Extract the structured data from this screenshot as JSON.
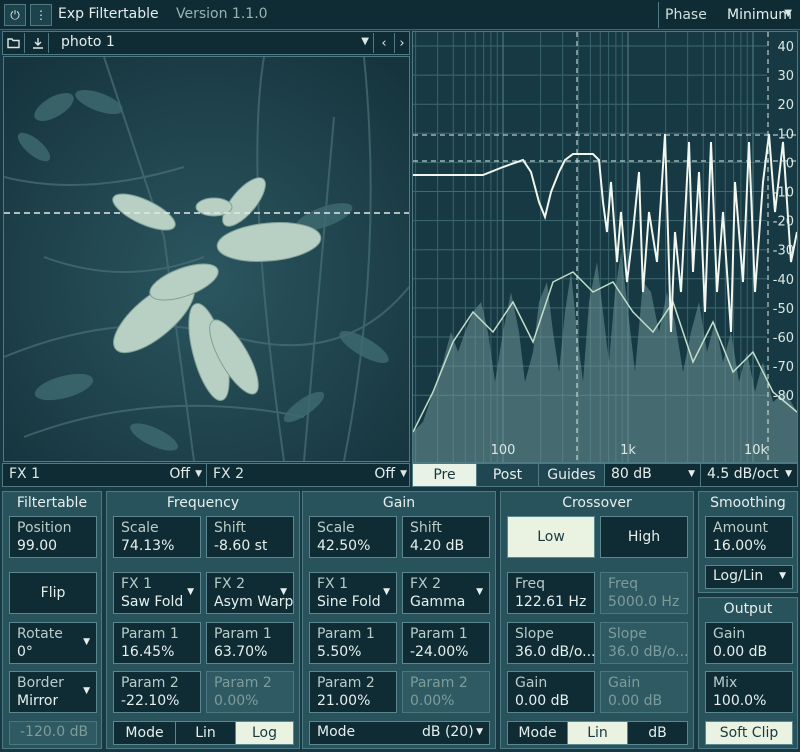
{
  "topbar": {
    "power_icon": "power-icon",
    "menu_icon": "menu-dots-icon",
    "title": "Exp Filtertable",
    "version": "Version 1.1.0",
    "phase_label": "Phase",
    "phase_value": "Minimum"
  },
  "image": {
    "preset": "photo 1"
  },
  "fx_row": {
    "fx1_label": "FX 1",
    "fx1_value": "Off",
    "fx2_label": "FX 2",
    "fx2_value": "Off"
  },
  "spectrum": {
    "db_ticks": [
      "40",
      "30",
      "20",
      "10",
      "0",
      "-10",
      "-20",
      "-30",
      "-40",
      "-50",
      "-60",
      "-70",
      "-80"
    ],
    "freq_ticks": [
      "100",
      "1k",
      "10k"
    ],
    "buttons": {
      "pre": "Pre",
      "post": "Post",
      "guides": "Guides"
    },
    "range": "80 dB",
    "slope": "4.5 dB/oct"
  },
  "filtertable": {
    "title": "Filtertable",
    "position_label": "Position",
    "position_value": "99.00",
    "flip": "Flip",
    "rotate_label": "Rotate",
    "rotate_value": "0°",
    "border_label": "Border",
    "border_value": "Mirror",
    "threshold": "-120.0 dB"
  },
  "frequency": {
    "title": "Frequency",
    "scale_label": "Scale",
    "scale_value": "74.13%",
    "shift_label": "Shift",
    "shift_value": "-8.60 st",
    "fx1_label": "FX 1",
    "fx1_value": "Saw Fold",
    "fx2_label": "FX 2",
    "fx2_value": "Asym Warp",
    "p1a_label": "Param 1",
    "p1a_value": "16.45%",
    "p1b_label": "Param 1",
    "p1b_value": "63.70%",
    "p2a_label": "Param 2",
    "p2a_value": "-22.10%",
    "p2b_label": "Param 2",
    "p2b_value": "0.00%",
    "mode": "Mode",
    "lin": "Lin",
    "log": "Log"
  },
  "gain": {
    "title": "Gain",
    "scale_label": "Scale",
    "scale_value": "42.50%",
    "shift_label": "Shift",
    "shift_value": "4.20 dB",
    "fx1_label": "FX 1",
    "fx1_value": "Sine Fold",
    "fx2_label": "FX 2",
    "fx2_value": "Gamma",
    "p1a_label": "Param 1",
    "p1a_value": "5.50%",
    "p1b_label": "Param 1",
    "p1b_value": "-24.00%",
    "p2a_label": "Param 2",
    "p2a_value": "21.00%",
    "p2b_label": "Param 2",
    "p2b_value": "0.00%",
    "mode": "Mode",
    "mode_value": "dB (20)"
  },
  "crossover": {
    "title": "Crossover",
    "low": "Low",
    "high": "High",
    "freq_label": "Freq",
    "freq_value": "122.61 Hz",
    "freq2_label": "Freq",
    "freq2_value": "5000.0 Hz",
    "slope_label": "Slope",
    "slope_value": "36.0 dB/o...",
    "slope2_label": "Slope",
    "slope2_value": "36.0 dB/o...",
    "gain_label": "Gain",
    "gain_value": "0.00 dB",
    "gain2_label": "Gain",
    "gain2_value": "0.00 dB",
    "mode": "Mode",
    "lin": "Lin",
    "db": "dB"
  },
  "smoothing": {
    "title": "Smoothing",
    "amount_label": "Amount",
    "amount_value": "16.00%",
    "mode_value": "Log/Lin"
  },
  "output": {
    "title": "Output",
    "gain_label": "Gain",
    "gain_value": "0.00 dB",
    "mix_label": "Mix",
    "mix_value": "100.0%",
    "soft_clip": "Soft Clip"
  },
  "colors": {
    "accent": "#eaf2e2",
    "panel": "#28525c",
    "dark": "#0f2c35"
  }
}
